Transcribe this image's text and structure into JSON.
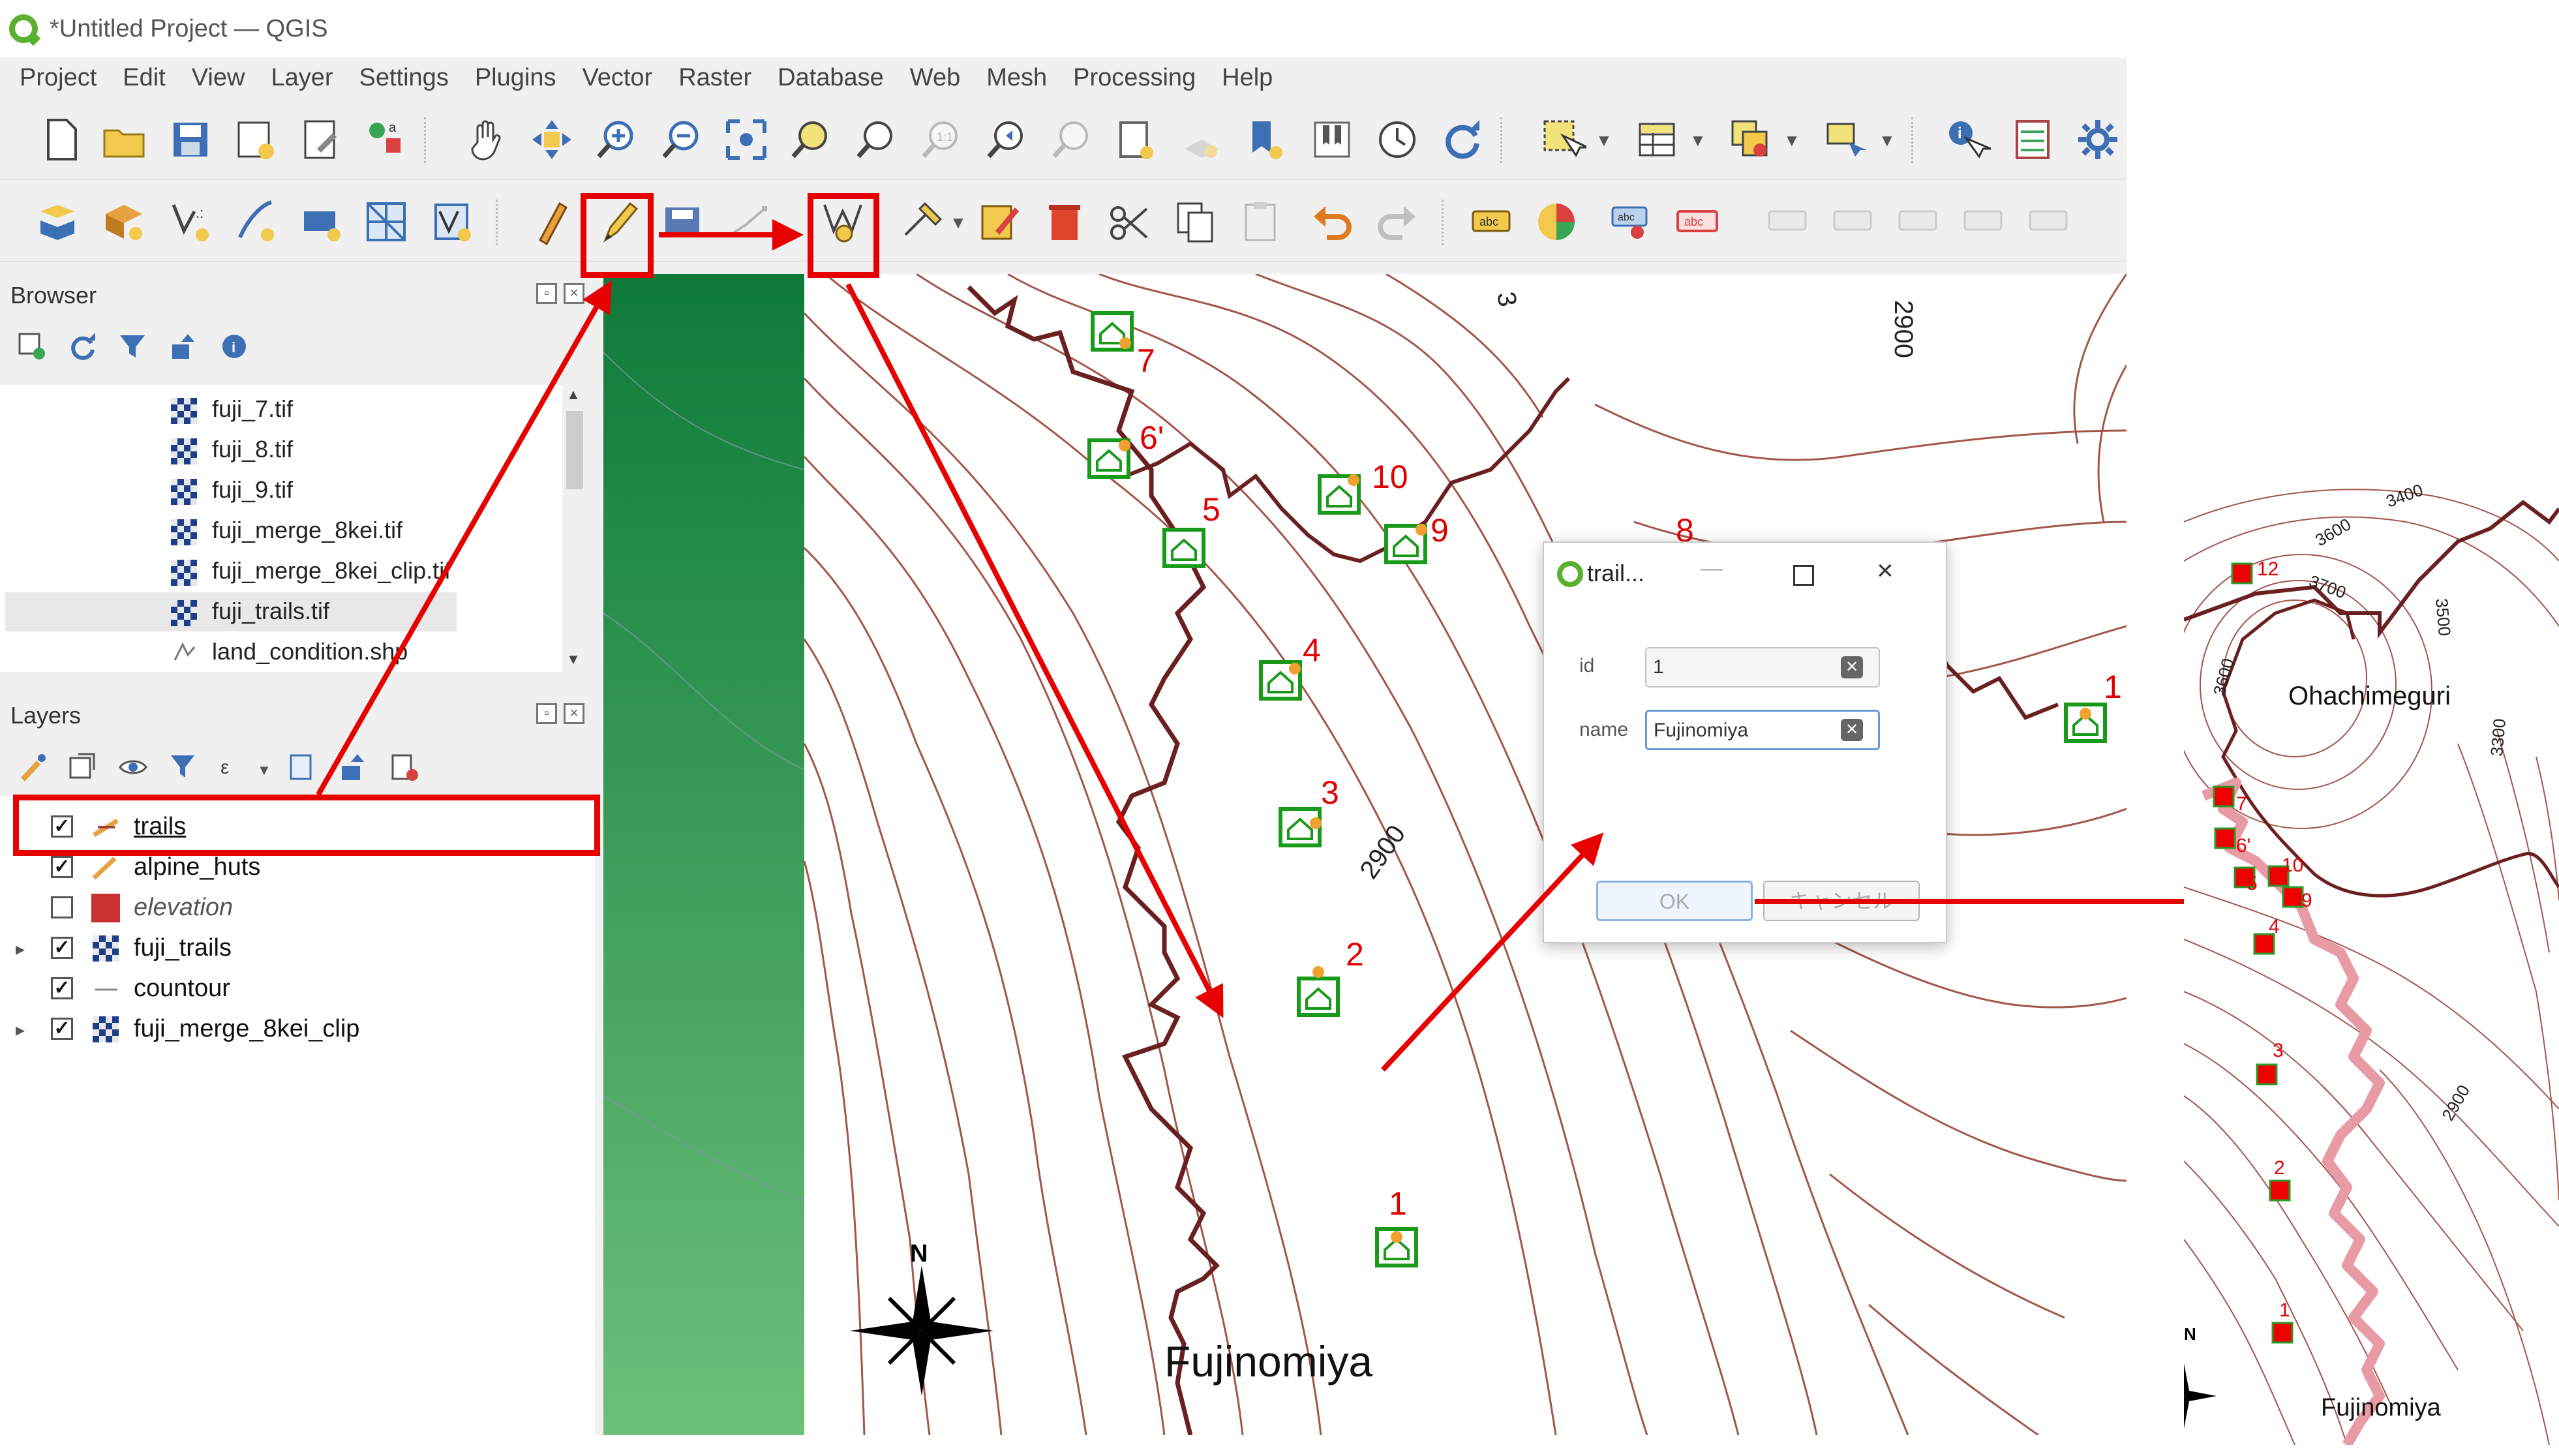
{
  "window": {
    "title": "*Untitled Project — QGIS"
  },
  "menu": [
    "Project",
    "Edit",
    "View",
    "Layer",
    "Settings",
    "Plugins",
    "Vector",
    "Raster",
    "Database",
    "Web",
    "Mesh",
    "Processing",
    "Help"
  ],
  "browser": {
    "title": "Browser",
    "items": [
      "fuji_7.tif",
      "fuji_8.tif",
      "fuji_9.tif",
      "fuji_merge_8kei.tif",
      "fuji_merge_8kei_clip.tif",
      "fuji_trails.tif",
      "land_condition.shp"
    ]
  },
  "layers": {
    "title": "Layers",
    "items": [
      {
        "name": "trails",
        "checked": true,
        "expander": false,
        "icon": "line-layer-icon"
      },
      {
        "name": "alpine_huts",
        "checked": true,
        "expander": false,
        "icon": "line-layer-icon"
      },
      {
        "name": "elevation",
        "checked": false,
        "expander": false,
        "icon": "polygon-layer-icon"
      },
      {
        "name": "fuji_trails",
        "checked": true,
        "expander": true,
        "icon": "raster-layer-icon"
      },
      {
        "name": "countour",
        "checked": true,
        "expander": false,
        "icon": "line-layer-icon"
      },
      {
        "name": "fuji_merge_8kei_clip",
        "checked": true,
        "expander": true,
        "icon": "raster-layer-icon"
      }
    ]
  },
  "map": {
    "place_label": "Fujinomiya",
    "contour_labels": [
      "2900",
      "2900",
      "3"
    ],
    "hut_numbers": [
      "7",
      "6'",
      "5",
      "10",
      "9",
      "4",
      "3",
      "2",
      "1",
      "8",
      "1"
    ],
    "north": "N"
  },
  "dialog": {
    "title": "trail...",
    "fields": [
      {
        "label": "id",
        "value": "1"
      },
      {
        "label": "name",
        "value": "Fujinomiya"
      }
    ],
    "ok_label": "OK",
    "cancel_label": "キャンセル"
  },
  "inset": {
    "crater_label": "Ohachimeguri",
    "place_label": "Fujinomiya",
    "contour_labels": [
      "3400",
      "3600",
      "3700",
      "3500",
      "3600",
      "3300",
      "2900"
    ],
    "point_numbers": [
      "12",
      "7",
      "6'",
      "5",
      "10",
      "9",
      "4",
      "3",
      "2",
      "1"
    ],
    "north": "N"
  },
  "colors": {
    "highlight": "#e60000",
    "trail_dark": "#6a2020",
    "trail_pink": "#e89aa5",
    "hut_green": "#1a9a1a",
    "point_red": "#ee0000",
    "contour": "#9b4a3a"
  }
}
